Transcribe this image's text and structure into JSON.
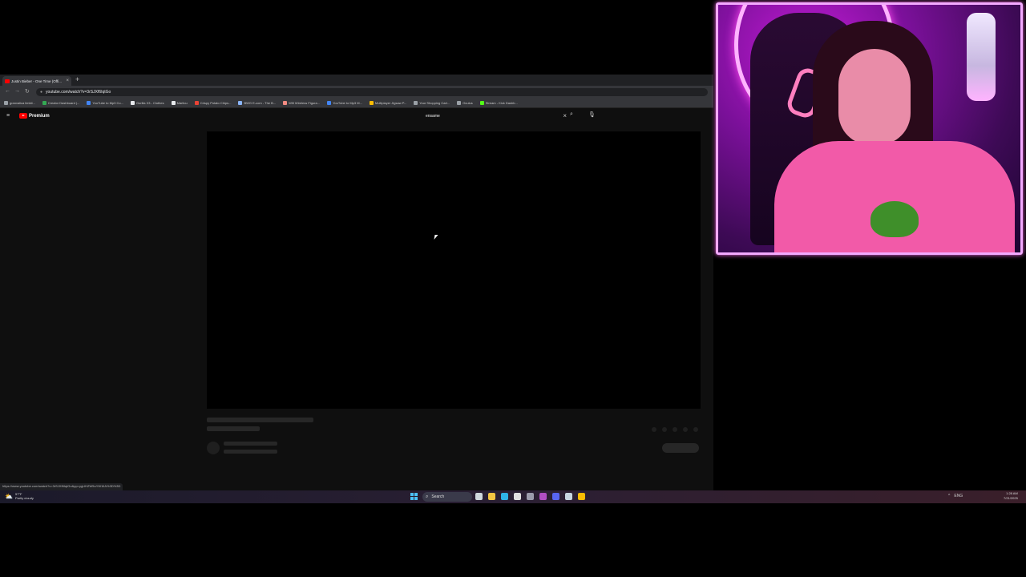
{
  "browser": {
    "tab": {
      "title": "Justin Bieber - One Time (Offi...",
      "close_glyph": "×"
    },
    "new_tab_glyph": "+",
    "nav": {
      "back_glyph": "←",
      "forward_glyph": "→",
      "reload_glyph": "↻"
    },
    "address": "youtube.com/watch?v=3rSJXf6IqtGo",
    "bookmarks": [
      {
        "label": "granvalica limbil...",
        "color": "#9aa0a6"
      },
      {
        "label": "Creator Dashboard |...",
        "color": "#34a853"
      },
      {
        "label": "YouTube to Mp3 Co...",
        "color": "#4285f4"
      },
      {
        "label": "Gorilla X3 - Clothes",
        "color": "#e8eaed"
      },
      {
        "label": "Marilou",
        "color": "#e8eaed"
      },
      {
        "label": "Crispy Potato Chips...",
        "color": "#ea4335"
      },
      {
        "label": "BWG E-com - The B...",
        "color": "#8ab4f8"
      },
      {
        "label": "Wifi Wireless Figura...",
        "color": "#f28b82"
      },
      {
        "label": "YouTube to Mp3 M...",
        "color": "#4285f4"
      },
      {
        "label": "Multiplayer Jigsaw P...",
        "color": "#fbbc04"
      },
      {
        "label": "Your Shopping Cart...",
        "color": "#9aa0a6"
      },
      {
        "label": "Oculus",
        "color": "#9aa0a6"
      },
      {
        "label": "Stream - Kick Dashb...",
        "color": "#53fc18"
      }
    ],
    "status_url": "https://www.youtube.com/watch?v=3rSJXf6IqtGo&pp=ygUHZW5uYW1lIA%3D%3D"
  },
  "youtube": {
    "brand": "Premium",
    "search_query": "ensame",
    "clear_glyph": "×",
    "search_glyph": "⌕",
    "mic_glyph": "🎙",
    "menu_glyph": "≡"
  },
  "taskbar": {
    "weather": {
      "temp": "57°F",
      "condition": "Partly cloudy",
      "icon": "⛅"
    },
    "search_label": "Search",
    "search_glyph": "⌕",
    "app_icons": [
      {
        "name": "task-view-icon",
        "color": "#cfd8dc"
      },
      {
        "name": "file-explorer-icon",
        "color": "#f4c542"
      },
      {
        "name": "edge-icon",
        "color": "#2fb4e9"
      },
      {
        "name": "store-icon",
        "color": "#e0e0e0"
      },
      {
        "name": "obs-icon",
        "color": "#9b9bab"
      },
      {
        "name": "app-icon",
        "color": "#b04ec2"
      },
      {
        "name": "discord-icon",
        "color": "#5865f2"
      },
      {
        "name": "steam-icon",
        "color": "#c7d5e0"
      },
      {
        "name": "chrome-icon",
        "color": "#fbbc04"
      }
    ],
    "tray": {
      "chevron": "^",
      "lang": "ENG"
    },
    "clock": {
      "time": "1:28 AM",
      "date": "7/21/2025"
    }
  },
  "colors": {
    "accent": "#ff0000",
    "webcam_border": "#f3a9ff"
  }
}
